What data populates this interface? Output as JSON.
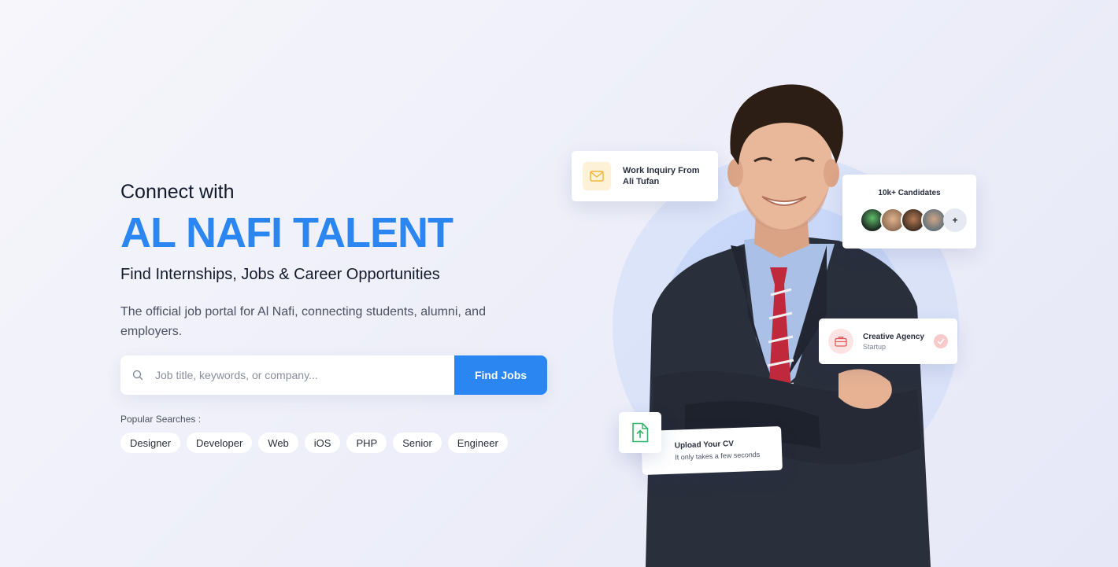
{
  "hero": {
    "eyebrow": "Connect with",
    "brand": "AL NAFI TALENT",
    "subtitle": "Find Internships, Jobs & Career Opportunities",
    "description": "The official job portal for Al Nafi, connecting students, alumni, and employers."
  },
  "search": {
    "placeholder": "Job title, keywords, or company...",
    "value": "",
    "button_label": "Find Jobs"
  },
  "popular": {
    "label": "Popular Searches :",
    "tags": [
      "Designer",
      "Developer",
      "Web",
      "iOS",
      "PHP",
      "Senior",
      "Engineer"
    ]
  },
  "cards": {
    "inquiry": {
      "line1": "Work Inquiry From",
      "line2": "Ali Tufan",
      "icon": "mail-icon"
    },
    "candidates": {
      "title": "10k+ Candidates",
      "more": "+"
    },
    "agency": {
      "title": "Creative Agency",
      "subtitle": "Startup",
      "icon": "briefcase-icon"
    },
    "upload": {
      "title": "Upload Your CV",
      "subtitle": "It only takes a few seconds",
      "icon": "file-upload-icon"
    }
  },
  "colors": {
    "accent": "#2b86f2",
    "mail_bg": "#fdf1d7",
    "agency_bg": "#fde3e3",
    "upload_green": "#34b36a"
  }
}
